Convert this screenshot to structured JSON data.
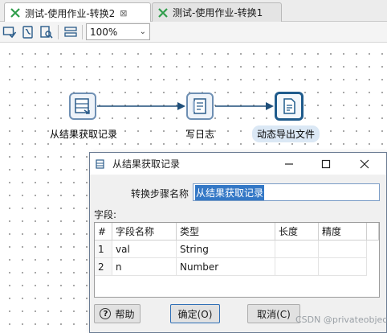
{
  "tabs": [
    {
      "label": "测试-使用作业-转换2",
      "active": true,
      "close": "⊠"
    },
    {
      "label": "测试-使用作业-转换1",
      "active": false
    }
  ],
  "toolbar": {
    "icons": [
      "verify-icon",
      "run-icon",
      "preview-icon",
      "fields-icon"
    ],
    "zoom": "100%"
  },
  "steps": [
    {
      "label": "从结果获取记录",
      "icon": "get-rows-from-result-icon"
    },
    {
      "label": "写日志",
      "icon": "write-to-log-icon"
    },
    {
      "label": "动态导出文件",
      "icon": "dynamic-export-file-icon",
      "selected": true
    }
  ],
  "dialog": {
    "title": "从结果获取记录",
    "step_name_label": "转换步骤名称",
    "step_name_value": "从结果获取记录",
    "fields_label": "字段:",
    "columns": [
      "#",
      "字段名称",
      "类型",
      "长度",
      "精度"
    ],
    "rows": [
      {
        "num": "1",
        "name": "val",
        "type": "String",
        "length": "",
        "precision": ""
      },
      {
        "num": "2",
        "name": "n",
        "type": "Number",
        "length": "",
        "precision": ""
      }
    ],
    "help_label": "帮助",
    "ok_label": "确定(O)",
    "cancel_label": "取消(C)"
  },
  "watermark": "CSDN @privateobject",
  "colors": {
    "accent": "#3478c6",
    "hop": "#1f4f7a",
    "step_border": "#6e8fb3"
  }
}
